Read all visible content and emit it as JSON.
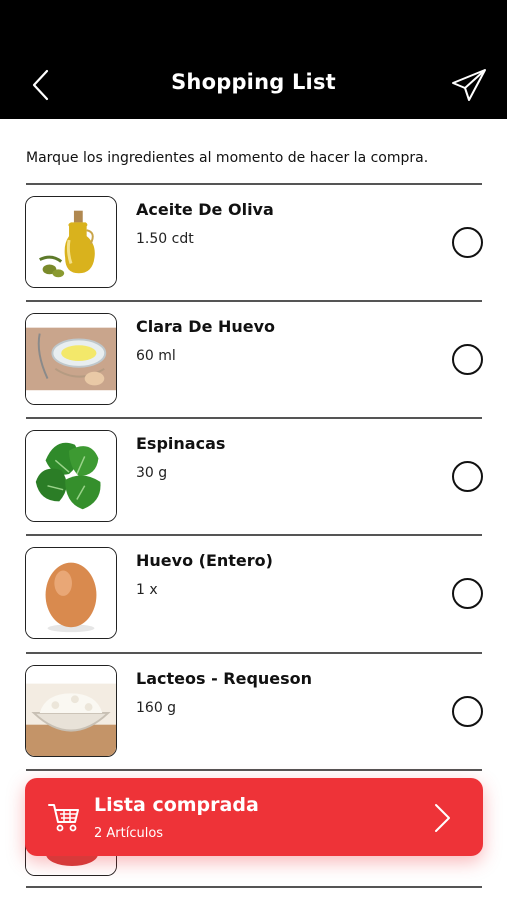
{
  "header": {
    "title": "Shopping List",
    "back_icon": "chevron-left-icon",
    "share_icon": "paper-plane-icon",
    "background": "#000000"
  },
  "instructions": "Marque los ingredientes al momento de hacer la compra.",
  "items": [
    {
      "name": "Aceite De Oliva",
      "quantity": "1.50 cdt",
      "image": "olive-oil-image",
      "checked": false
    },
    {
      "name": "Clara De Huevo",
      "quantity": "60 ml",
      "image": "egg-white-image",
      "checked": false
    },
    {
      "name": "Espinacas",
      "quantity": "30 g",
      "image": "spinach-image",
      "checked": false
    },
    {
      "name": "Huevo (Entero)",
      "quantity": "1 x",
      "image": "egg-image",
      "checked": false
    },
    {
      "name": "Lacteos - Requeson",
      "quantity": "160 g",
      "image": "cottage-cheese-image",
      "checked": false
    }
  ],
  "purchased_bar": {
    "title": "Lista comprada",
    "subtitle": "2 Artículos",
    "cart_icon": "shopping-cart-icon",
    "arrow_icon": "chevron-right-icon",
    "color": "#ee3338"
  }
}
